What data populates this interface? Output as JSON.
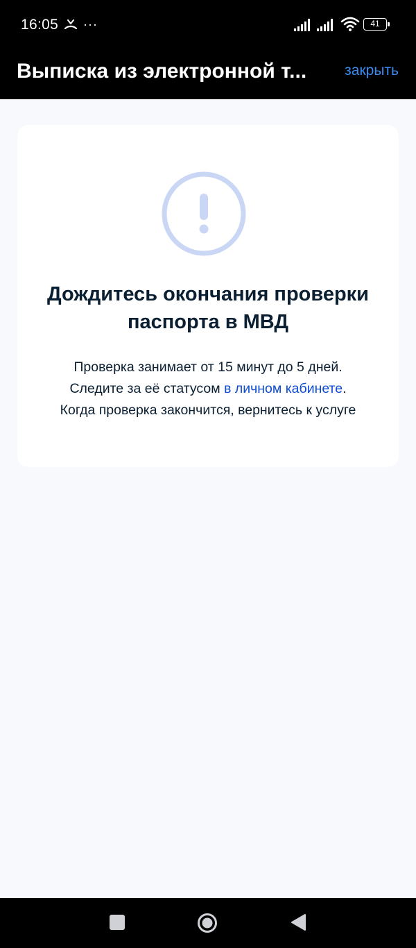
{
  "status_bar": {
    "time": "16:05",
    "more_label": "···",
    "battery_level": "41",
    "icons": [
      "missed-call-icon",
      "more-icon",
      "signal-icon",
      "signal-icon",
      "wifi-icon",
      "battery-icon"
    ]
  },
  "header": {
    "title": "Выписка из электронной т...",
    "close_label": "закрыть"
  },
  "card": {
    "icon": "exclamation-circle-icon",
    "heading": "Дождитесь окончания проверки паспорта в МВД",
    "line1": "Проверка занимает от 15 минут до 5 дней.",
    "line2_prefix": "Следите за её статусом ",
    "line2_link": "в личном кабинете",
    "line2_suffix": ".",
    "line3": "Когда проверка закончится, вернитесь к услуге"
  },
  "nav_bar": {
    "icons": [
      "recents-square-icon",
      "home-circle-icon",
      "back-triangle-icon"
    ]
  },
  "colors": {
    "header_bg": "#000000",
    "page_bg": "#f8f9fc",
    "card_bg": "#ffffff",
    "text": "#0b1f33",
    "link": "#0d4cd3",
    "close_link": "#3a8bf0",
    "icon_accent": "#c9d7f5"
  }
}
